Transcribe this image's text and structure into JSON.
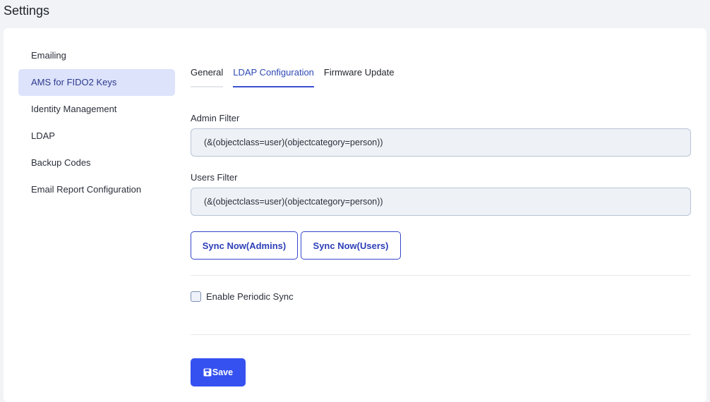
{
  "page": {
    "title": "Settings"
  },
  "sidebar": {
    "items": [
      {
        "label": "Emailing"
      },
      {
        "label": "AMS for FIDO2 Keys"
      },
      {
        "label": "Identity Management"
      },
      {
        "label": "LDAP"
      },
      {
        "label": "Backup Codes"
      },
      {
        "label": "Email Report Configuration"
      }
    ],
    "active_index": 1
  },
  "tabs": [
    {
      "label": "General"
    },
    {
      "label": "LDAP Configuration"
    },
    {
      "label": "Firmware Update"
    }
  ],
  "form": {
    "admin_filter": {
      "label": "Admin Filter",
      "value": "(&(objectclass=user)(objectcategory=person))"
    },
    "users_filter": {
      "label": "Users Filter",
      "value": "(&(objectclass=user)(objectcategory=person))"
    },
    "sync_admins_label": "Sync Now(Admins)",
    "sync_users_label": "Sync Now(Users)",
    "periodic_sync_label": "Enable Periodic Sync",
    "periodic_sync_checked": false,
    "save_label": "Save"
  },
  "colors": {
    "accent": "#3551f0",
    "active_sidebar_bg": "#dde3fb"
  }
}
